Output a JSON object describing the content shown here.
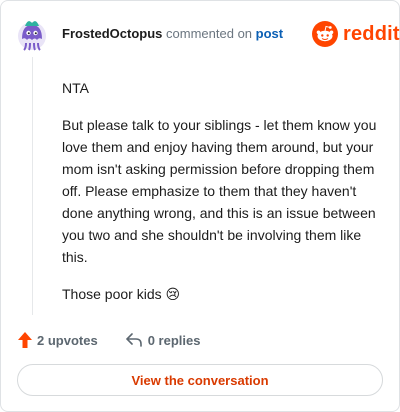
{
  "comment": {
    "author": "FrostedOctopus",
    "action_text": "commented on",
    "target_link": "post",
    "paragraphs": [
      "NTA",
      "But please talk to your siblings - let them know you love them and enjoy having them around, but your mom isn't asking permission before dropping them off. Please emphasize to them that they haven't done anything wrong, and this is an issue between you two and she shouldn't be involving them like this.",
      "Those poor kids 😢"
    ]
  },
  "brand": {
    "name": "reddit",
    "color": "#ff4500"
  },
  "actions": {
    "upvotes_label": "2 upvotes",
    "replies_label": "0 replies",
    "upvote_icon": "upvote-arrow-icon",
    "reply_icon": "reply-arrow-icon",
    "upvote_color": "#ff4500"
  },
  "cta": {
    "label": "View the conversation",
    "color": "#d93a00"
  }
}
